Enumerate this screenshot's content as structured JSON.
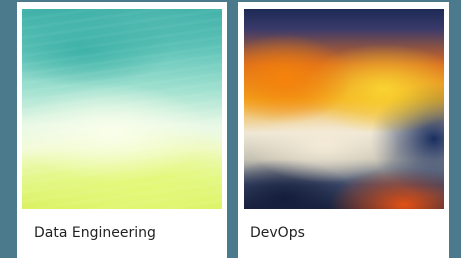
{
  "cards": [
    {
      "title": "Data Engineering",
      "thumbnail": "teal-to-lime-gradient"
    },
    {
      "title": "DevOps",
      "thumbnail": "orange-yellow-navy-gradient"
    }
  ],
  "colors": {
    "background": "#4a7a8c",
    "card": "#ffffff",
    "text": "#222222"
  }
}
